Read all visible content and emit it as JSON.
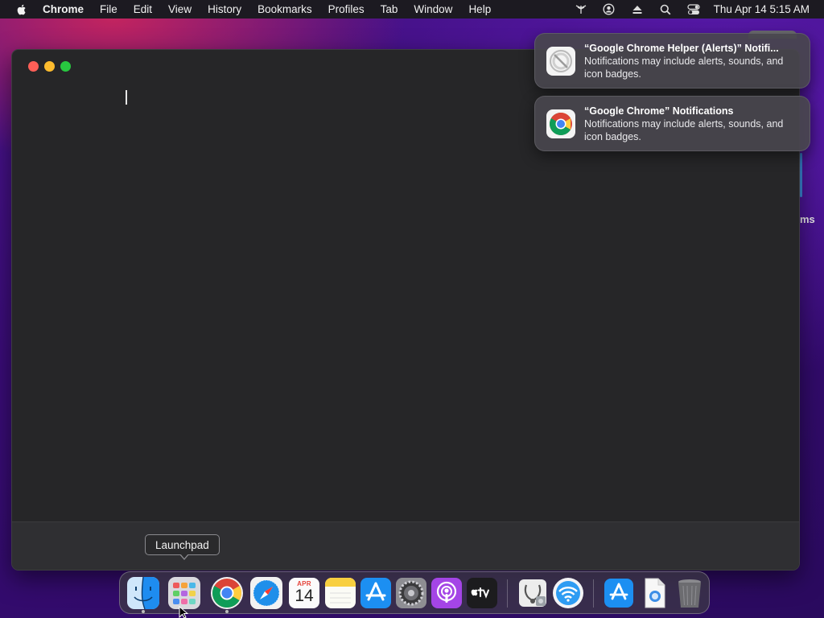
{
  "menubar": {
    "app_name": "Chrome",
    "items": [
      "File",
      "Edit",
      "View",
      "History",
      "Bookmarks",
      "Profiles",
      "Tab",
      "Window",
      "Help"
    ],
    "status_icons": [
      "wifi-signal-icon",
      "user-account-icon",
      "eject-icon",
      "spotlight-search-icon",
      "control-center-icon"
    ],
    "clock": "Thu Apr 14  5:15 AM"
  },
  "window": {
    "app": "Google Chrome",
    "traffic_lights": {
      "close": "#fe5f57",
      "minimize": "#febc2e",
      "maximize": "#28c840"
    }
  },
  "background_window_fragment": {
    "text": "ms"
  },
  "notifications": [
    {
      "title": "“Google Chrome Helper (Alerts)” Notifi...",
      "body": "Notifications may include alerts, sounds, and icon badges.",
      "icon": "chrome-helper-icon"
    },
    {
      "title": "“Google Chrome” Notifications",
      "body": "Notifications may include alerts, sounds, and icon badges.",
      "icon": "chrome-icon"
    }
  ],
  "tooltip": {
    "text": "Launchpad"
  },
  "dock": {
    "calendar": {
      "month": "APR",
      "day": "14"
    },
    "items": [
      {
        "name": "Finder",
        "icon": "finder-icon",
        "running": true
      },
      {
        "name": "Launchpad",
        "icon": "launchpad-icon",
        "running": false
      },
      {
        "name": "Google Chrome",
        "icon": "chrome-icon",
        "running": true
      },
      {
        "name": "Safari",
        "icon": "safari-icon",
        "running": false
      },
      {
        "name": "Calendar",
        "icon": "calendar-icon",
        "running": false
      },
      {
        "name": "Notes",
        "icon": "notes-icon",
        "running": false
      },
      {
        "name": "App Store",
        "icon": "app-store-icon",
        "running": false
      },
      {
        "name": "System Preferences",
        "icon": "system-preferences-icon",
        "running": false
      },
      {
        "name": "Podcasts",
        "icon": "podcasts-icon",
        "running": false
      },
      {
        "name": "TV",
        "icon": "apple-tv-icon",
        "running": false
      },
      {
        "name": "Disk Utility",
        "icon": "disk-utility-icon",
        "running": false
      },
      {
        "name": "Wireless Diagnostics",
        "icon": "wireless-diagnostics-icon",
        "running": false
      },
      {
        "name": "App Store Downloads",
        "icon": "app-store-folder-icon",
        "running": false
      },
      {
        "name": "Document",
        "icon": "document-icon",
        "running": false
      },
      {
        "name": "Trash",
        "icon": "trash-icon",
        "running": false
      }
    ]
  }
}
